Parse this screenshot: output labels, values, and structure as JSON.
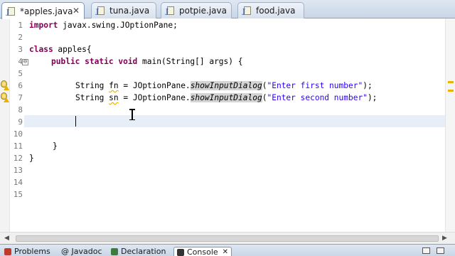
{
  "editor_tabs": [
    {
      "label": "*apples.java",
      "active": true
    },
    {
      "label": "tuna.java",
      "active": false
    },
    {
      "label": "potpie.java",
      "active": false
    },
    {
      "label": "food.java",
      "active": false
    }
  ],
  "tab_close_glyph": "✕",
  "line_numbers": [
    "1",
    "2",
    "3",
    "4",
    "5",
    "6",
    "7",
    "8",
    "9",
    "10",
    "11",
    "12",
    "13",
    "14",
    "15"
  ],
  "fold_glyph": "⊖",
  "code": {
    "l1": {
      "kw": "import",
      "text": " javax.swing.JOptionPane;"
    },
    "l3": {
      "kw": "class",
      "text": " apples{"
    },
    "l4": {
      "kw1": "public",
      "kw2": "static",
      "kw3": "void",
      "text": " main(String[] args) {"
    },
    "l6": {
      "type": "String ",
      "var": "fn",
      "mid": " = JOptionPane.",
      "method": "showInputDialog",
      "open": "(",
      "str": "\"Enter first number\"",
      "close": ");"
    },
    "l7": {
      "type": "String ",
      "var": "sn",
      "mid": " = JOptionPane.",
      "method": "showInputDialog",
      "open": "(",
      "str": "\"Enter second number\"",
      "close": ");"
    },
    "l11": {
      "text": "}"
    },
    "l12": {
      "text": "}"
    }
  },
  "bottom_tabs": [
    {
      "label": "Problems",
      "icon_color": "#c0392b"
    },
    {
      "label": "@ Javadoc",
      "icon_color": "#4a6fa5"
    },
    {
      "label": "Declaration",
      "icon_color": "#3b7d3b"
    },
    {
      "label": "Console",
      "icon_color": "#333333",
      "active": true
    }
  ],
  "colors": {
    "keyword": "#7f0055",
    "string": "#2a00ff",
    "warning": "#e8b400",
    "current_line": "#e8eef8"
  },
  "icons": [
    "java-file-icon",
    "close-icon",
    "fold-icon",
    "quick-fix-bulb-icon",
    "warning-icon",
    "text-cursor-icon",
    "minimize-icon",
    "maximize-icon"
  ]
}
